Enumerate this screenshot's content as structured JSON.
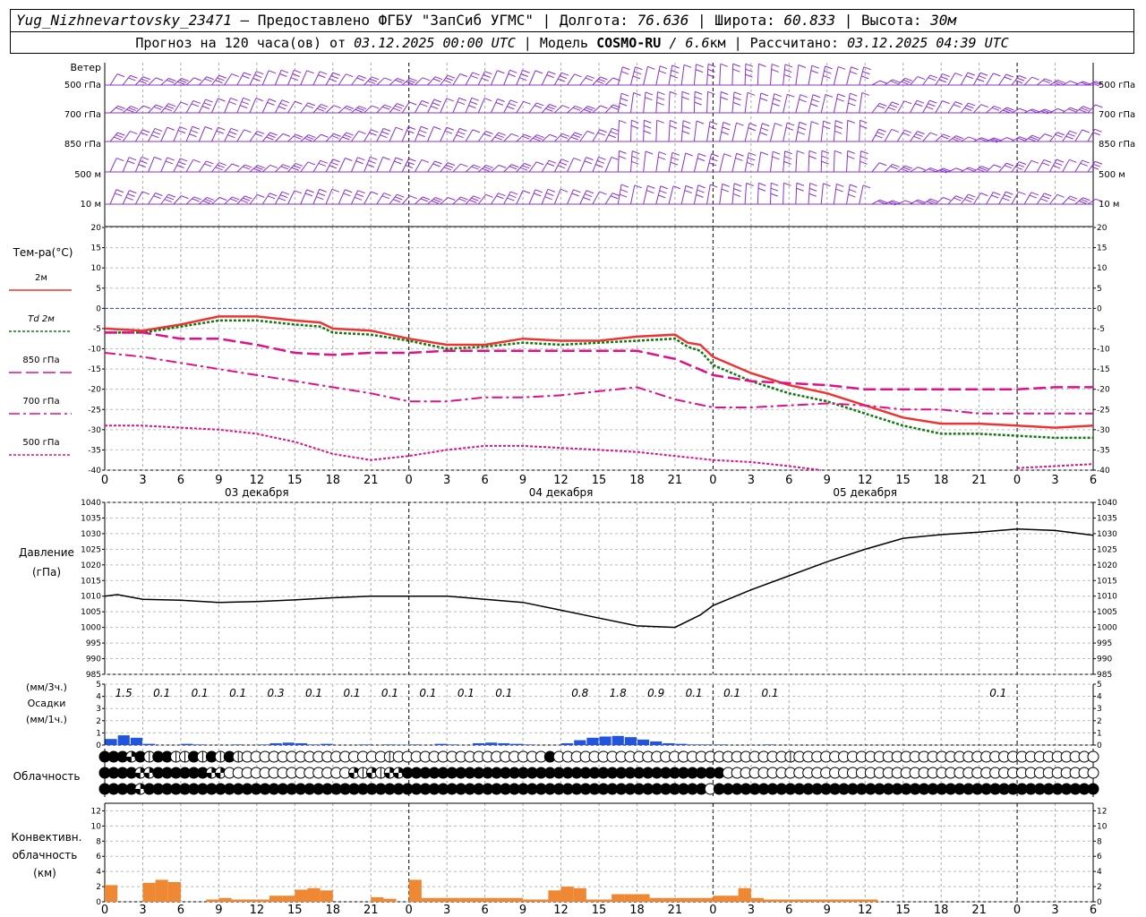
{
  "header": {
    "station": "Yug_Nizhnevartovsky_23471",
    "provider": " – Предоставлено ФГБУ \"ЗапСиб УГМС\" | Долгота: ",
    "lon": "76.636",
    "lat_label": " | Широта: ",
    "lat": "60.833",
    "alt_label": " | Высота: ",
    "alt": "30м",
    "forecast_prefix": "Прогноз на 120 часа(ов) от ",
    "forecast_time": "03.12.2025 00:00 UTC",
    "model_label": "  | Модель ",
    "model": "COSMO-RU",
    "res": " / 6.6",
    "res_unit": "км",
    "calc_label": " | Рассчитано: ",
    "calc_time": "03.12.2025 04:39 UTC"
  },
  "wind_panel": {
    "title": "Ветер",
    "levels": [
      "500 гПа",
      "700 гПа",
      "850 гПа",
      "500 м",
      "10  м"
    ]
  },
  "temp_panel": {
    "title": "Тем-ра(°С)",
    "legend": [
      {
        "label": "2м",
        "color": "#ee3333",
        "dash": ""
      },
      {
        "label": "Td  2м",
        "color": "#117711",
        "dash": "3,2"
      },
      {
        "label": "850 гПа",
        "color": "#dd1188",
        "dash": "14,5"
      },
      {
        "label": "700 гПа",
        "color": "#dd1188",
        "dash": "12,4,3,4"
      },
      {
        "label": "500 гПа",
        "color": "#dd1188",
        "dash": "3,2"
      }
    ],
    "days": [
      "03 декабря",
      "04 декабря",
      "05 декабря"
    ]
  },
  "pressure_panel": {
    "title1": "Давление",
    "title2": "(гПа)"
  },
  "precip_panel": {
    "title1": "(мм/3ч.)",
    "title2": "Осадки",
    "title3": "(мм/1ч.)"
  },
  "cloud_panel": {
    "title": "Облачность"
  },
  "conv_panel": {
    "title1": "Конвективн.",
    "title2": "облачность",
    "title3": "(км)"
  },
  "colors": {
    "wind": "#8833cc",
    "precip": "#2255dd",
    "conv": "#ee8833",
    "zero": "#3344dd"
  },
  "chart_data": [
    {
      "type": "line",
      "name": "temperature",
      "ylabel": "Тем-ра(°С)",
      "ylim": [
        -40,
        20
      ],
      "yticks": [
        20,
        15,
        10,
        5,
        0,
        -5,
        -10,
        -15,
        -20,
        -25,
        -30,
        -35,
        -40
      ],
      "xlim_hours": [
        0,
        78
      ],
      "xticklabels": [
        "0",
        "3",
        "6",
        "9",
        "12",
        "15",
        "18",
        "21",
        "0",
        "3",
        "6",
        "9",
        "12",
        "15",
        "18",
        "21",
        "0",
        "3",
        "6",
        "9",
        "12",
        "15",
        "18",
        "21",
        "0",
        "3",
        "6"
      ],
      "series": [
        {
          "name": "2м",
          "x": [
            0,
            3,
            6,
            9,
            12,
            15,
            17,
            18,
            21,
            24,
            27,
            30,
            33,
            36,
            39,
            42,
            45,
            46,
            47,
            48,
            51,
            54,
            57,
            60,
            63,
            66,
            69,
            72,
            75,
            78
          ],
          "values": [
            -5,
            -5.5,
            -4,
            -2,
            -2,
            -3,
            -3.5,
            -5,
            -5.5,
            -7.5,
            -9,
            -9,
            -7.5,
            -8,
            -8,
            -7,
            -6.5,
            -8.5,
            -9,
            -12,
            -16,
            -19,
            -21,
            -24,
            -27,
            -28.5,
            -28.5,
            -29,
            -29.5,
            -29
          ]
        },
        {
          "name": "Td  2м",
          "x": [
            0,
            3,
            6,
            9,
            12,
            15,
            17,
            18,
            21,
            24,
            27,
            30,
            33,
            36,
            39,
            42,
            45,
            46,
            47,
            48,
            51,
            54,
            57,
            60,
            63,
            66,
            69,
            72,
            75,
            78
          ],
          "values": [
            -6,
            -6,
            -4.5,
            -3,
            -3,
            -4,
            -4.5,
            -6,
            -6.5,
            -8,
            -10,
            -9.5,
            -8.5,
            -9,
            -8.5,
            -8,
            -7.5,
            -9.5,
            -10.5,
            -14,
            -18,
            -21,
            -23,
            -26,
            -29,
            -31,
            -31,
            -31.5,
            -32,
            -32
          ]
        },
        {
          "name": "850 гПа",
          "x": [
            0,
            3,
            6,
            9,
            12,
            15,
            18,
            21,
            24,
            27,
            30,
            33,
            36,
            39,
            42,
            45,
            48,
            51,
            54,
            57,
            60,
            63,
            66,
            69,
            72,
            75,
            78
          ],
          "values": [
            -6,
            -6,
            -7.5,
            -7.5,
            -9,
            -11,
            -11.5,
            -11,
            -11,
            -10.5,
            -10.5,
            -10.5,
            -10.5,
            -10.5,
            -10.5,
            -12.5,
            -16.5,
            -18,
            -18.5,
            -19,
            -20,
            -20,
            -20,
            -20,
            -20,
            -19.5,
            -19.5
          ]
        },
        {
          "name": "700 гПа",
          "x": [
            0,
            3,
            6,
            9,
            12,
            15,
            18,
            21,
            24,
            27,
            30,
            33,
            36,
            39,
            42,
            45,
            48,
            51,
            54,
            57,
            60,
            63,
            66,
            69,
            72,
            75,
            78
          ],
          "values": [
            -11,
            -12,
            -13.5,
            -15,
            -16.5,
            -18,
            -19.5,
            -21,
            -23,
            -23,
            -22,
            -22,
            -21.5,
            -20.5,
            -19.5,
            -22.5,
            -24.5,
            -24.5,
            -24,
            -23.5,
            -24,
            -25,
            -25,
            -26,
            -26,
            -26,
            -26
          ]
        },
        {
          "name": "500 гПа",
          "x": [
            0,
            3,
            6,
            9,
            12,
            15,
            18,
            21,
            24,
            27,
            30,
            33,
            36,
            39,
            42,
            45,
            48,
            51,
            54,
            56.5
          ],
          "values": [
            -29,
            -29,
            -29.5,
            -30,
            -31,
            -33,
            -36,
            -37.5,
            -36.5,
            -35,
            -34,
            -34,
            -34.5,
            -35,
            -35.5,
            -36.5,
            -37.5,
            -38,
            -39,
            -40
          ]
        },
        {
          "name": "500 гПа",
          "x": [
            72,
            75,
            78
          ],
          "values": [
            -39.5,
            -39,
            -38.5
          ]
        }
      ]
    },
    {
      "type": "line",
      "name": "pressure",
      "ylabel": "Давление (гПа)",
      "ylim": [
        985,
        1040
      ],
      "yticks": [
        1040,
        1035,
        1030,
        1025,
        1020,
        1015,
        1010,
        1005,
        1000,
        995,
        990,
        985
      ],
      "series": [
        {
          "name": "Давление",
          "x": [
            0,
            1,
            3,
            6,
            9,
            12,
            15,
            18,
            21,
            24,
            27,
            30,
            33,
            36,
            39,
            42,
            45,
            47,
            48,
            51,
            54,
            57,
            60,
            63,
            66,
            69,
            72,
            75,
            78
          ],
          "values": [
            1010,
            1010.5,
            1009,
            1008.7,
            1008,
            1008.3,
            1008.8,
            1009.5,
            1010,
            1010,
            1010,
            1009,
            1008,
            1005.5,
            1003,
            1000.5,
            1000,
            1004,
            1007,
            1012,
            1016.5,
            1021,
            1025,
            1028.5,
            1029.7,
            1030.5,
            1031.5,
            1031,
            1029.5
          ]
        }
      ]
    },
    {
      "type": "bar",
      "name": "precipitation",
      "ylabel": "Осадки (мм/1ч.)",
      "ylim": [
        0,
        5
      ],
      "yticks": [
        5,
        4,
        3,
        2,
        1,
        0
      ],
      "x": [
        0,
        1,
        2,
        3,
        4,
        5,
        6,
        7,
        8,
        9,
        10,
        11,
        12,
        13,
        14,
        15,
        16,
        17,
        18,
        19,
        20,
        21,
        22,
        23,
        24,
        25,
        26,
        27,
        28,
        29,
        30,
        31,
        32,
        33,
        34,
        35,
        36,
        37,
        38,
        39,
        40,
        41,
        42,
        43,
        44,
        45,
        46,
        47,
        48,
        49,
        50,
        51,
        52,
        53,
        54,
        55,
        56,
        57,
        58,
        59,
        60,
        61,
        62,
        63,
        64,
        65,
        66,
        67,
        68,
        69,
        70,
        71,
        72,
        73,
        74,
        75,
        76,
        77
      ],
      "values": [
        0.5,
        0.8,
        0.6,
        0.1,
        0,
        0,
        0.1,
        0.05,
        0,
        0,
        0.05,
        0,
        0.05,
        0.15,
        0.2,
        0.15,
        0.05,
        0.1,
        0,
        0,
        0.05,
        0,
        0.05,
        0.02,
        0.05,
        0,
        0.1,
        0.05,
        0,
        0.15,
        0.2,
        0.15,
        0.1,
        0.05,
        0,
        0,
        0.15,
        0.4,
        0.6,
        0.7,
        0.75,
        0.65,
        0.45,
        0.3,
        0.15,
        0.1,
        0.05,
        0.05,
        0.05,
        0,
        0,
        0,
        0.05,
        0,
        0,
        0,
        0,
        0,
        0,
        0,
        0,
        0,
        0,
        0,
        0,
        0,
        0,
        0,
        0,
        0,
        0,
        0,
        0,
        0,
        0,
        0,
        0,
        0
      ],
      "labels3h": [
        {
          "x": 1.5,
          "text": "1.5"
        },
        {
          "x": 4.5,
          "text": "0.1"
        },
        {
          "x": 7.5,
          "text": "0.1"
        },
        {
          "x": 10.5,
          "text": "0.1"
        },
        {
          "x": 13.5,
          "text": "0.3"
        },
        {
          "x": 16.5,
          "text": "0.1"
        },
        {
          "x": 19.5,
          "text": "0.1"
        },
        {
          "x": 22.5,
          "text": "0.1"
        },
        {
          "x": 25.5,
          "text": "0.1"
        },
        {
          "x": 28.5,
          "text": "0.1"
        },
        {
          "x": 31.5,
          "text": "0.1"
        },
        {
          "x": 37.5,
          "text": "0.8"
        },
        {
          "x": 40.5,
          "text": "1.8"
        },
        {
          "x": 43.5,
          "text": "0.9"
        },
        {
          "x": 46.5,
          "text": "0.1"
        },
        {
          "x": 49.5,
          "text": "0.1"
        },
        {
          "x": 52.5,
          "text": "0.1"
        },
        {
          "x": 70.5,
          "text": "0.1"
        }
      ]
    },
    {
      "type": "table",
      "name": "cloudiness",
      "rows": [
        "3332313311313131000000000000000010000000000000000030000000000000000000000000010000000000000000000000000000000000",
        "3333223333332200000000000000212122333333333333333333333333333333333333000000000000000000000000000000000000000000",
        "3333233333333333333333333333333333333333333333333333333333333333333303333333333333333333333333333333333333333333"
      ]
    },
    {
      "type": "bar",
      "name": "convective_cloud",
      "ylabel": "Конвективн. облачность (км)",
      "ylim": [
        0,
        13
      ],
      "yticks": [
        12,
        10,
        8,
        6,
        4,
        2,
        0
      ],
      "x": [
        0,
        1,
        2,
        3,
        4,
        5,
        6,
        7,
        8,
        9,
        10,
        11,
        12,
        13,
        14,
        15,
        16,
        17,
        18,
        19,
        20,
        21,
        22,
        23,
        24,
        25,
        26,
        27,
        28,
        29,
        30,
        31,
        32,
        33,
        34,
        35,
        36,
        37,
        38,
        39,
        40,
        41,
        42,
        43,
        44,
        45,
        46,
        47,
        48,
        49,
        50,
        51,
        52,
        53,
        54,
        55,
        56,
        57,
        58,
        59,
        60,
        61,
        62,
        63,
        64,
        65,
        66,
        67,
        68,
        69,
        70,
        71,
        72,
        73,
        74,
        75,
        76,
        77
      ],
      "values": [
        2.2,
        0,
        0,
        2.5,
        2.9,
        2.6,
        0,
        0,
        0.3,
        0.5,
        0.3,
        0.3,
        0.3,
        0.8,
        0.8,
        1.6,
        1.8,
        1.5,
        0,
        0,
        0,
        0.6,
        0.4,
        0,
        2.9,
        0.5,
        0.5,
        0.5,
        0.5,
        0.5,
        0.5,
        0.5,
        0.5,
        0.3,
        0.3,
        1.5,
        2,
        1.8,
        0.3,
        0.3,
        1,
        1,
        1,
        0.5,
        0.5,
        0.5,
        0.5,
        0.5,
        0.8,
        0.8,
        1.8,
        0.5,
        0.3,
        0.3,
        0.3,
        0.3,
        0.3,
        0.3,
        0.3,
        0.3,
        0.3,
        0,
        0,
        0,
        0,
        0,
        0,
        0,
        0,
        0,
        0,
        0,
        0,
        0,
        0,
        0,
        0,
        0
      ]
    }
  ]
}
